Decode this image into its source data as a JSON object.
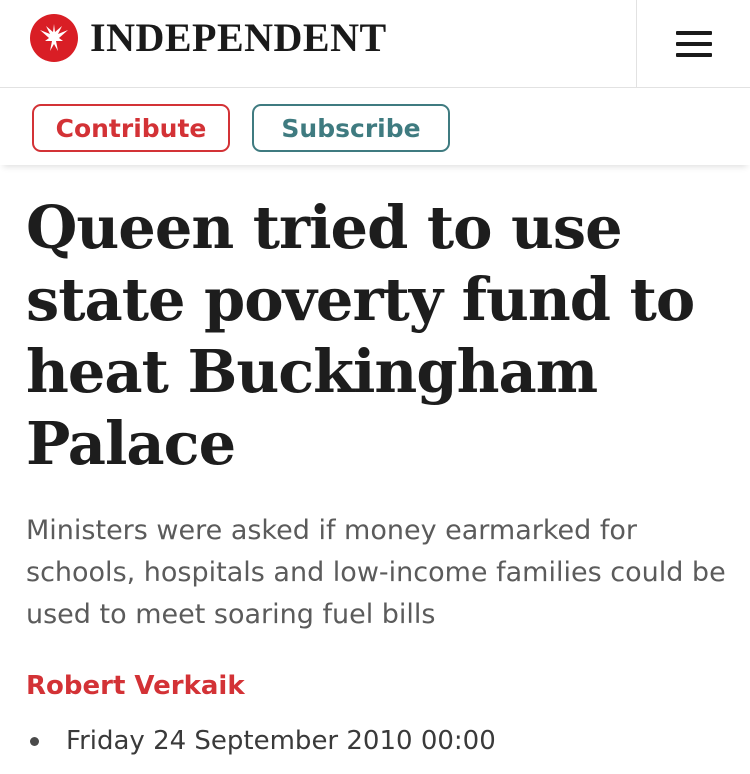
{
  "header": {
    "brand": "INDEPENDENT",
    "logo_icon": "eagle-icon",
    "menu_icon": "hamburger-menu-icon",
    "brand_color": "#d91e25"
  },
  "actions": {
    "contribute_label": "Contribute",
    "subscribe_label": "Subscribe",
    "contribute_color": "#d33236",
    "subscribe_color": "#3f7b80"
  },
  "article": {
    "headline": "Queen tried to use state poverty fund to heat Buckingham Palace",
    "standfirst": "Ministers were asked if money earmarked for schools, hospitals and low-income families could be used to meet soaring fuel bills",
    "author": "Robert Verkaik",
    "date": "Friday 24 September 2010 00:00"
  }
}
